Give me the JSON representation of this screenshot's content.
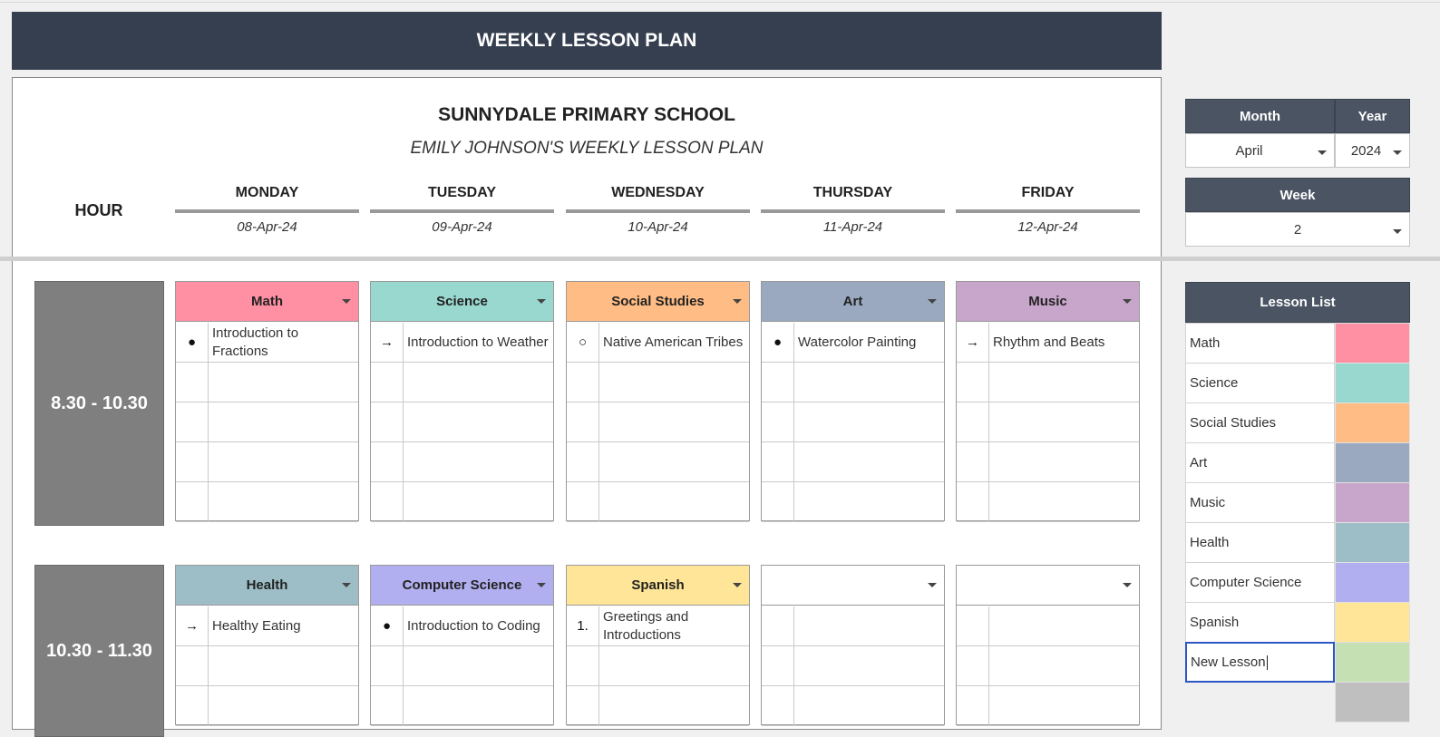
{
  "banner": {
    "title": "WEEKLY LESSON PLAN"
  },
  "header": {
    "school": "SUNNYDALE PRIMARY SCHOOL",
    "subtitle": "EMILY JOHNSON'S WEEKLY LESSON PLAN",
    "hour_label": "HOUR"
  },
  "days": [
    {
      "name": "MONDAY",
      "date": "08-Apr-24"
    },
    {
      "name": "TUESDAY",
      "date": "09-Apr-24"
    },
    {
      "name": "WEDNESDAY",
      "date": "10-Apr-24"
    },
    {
      "name": "THURSDAY",
      "date": "11-Apr-24"
    },
    {
      "name": "FRIDAY",
      "date": "12-Apr-24"
    }
  ],
  "periods": [
    {
      "time": "8.30 - 10.30",
      "lessons": [
        {
          "subject": "Math",
          "color": "#ff8fa3",
          "items": [
            {
              "mark": "●",
              "text": "Introduction to Fractions"
            }
          ]
        },
        {
          "subject": "Science",
          "color": "#99d8cf",
          "items": [
            {
              "mark": "→",
              "text": "Introduction to Weather"
            }
          ]
        },
        {
          "subject": "Social Studies",
          "color": "#ffbd85",
          "items": [
            {
              "mark": "○",
              "text": "Native American Tribes"
            }
          ]
        },
        {
          "subject": "Art",
          "color": "#9aa9bf",
          "items": [
            {
              "mark": "●",
              "text": "Watercolor Painting"
            }
          ]
        },
        {
          "subject": "Music",
          "color": "#c8a5cb",
          "items": [
            {
              "mark": "→",
              "text": "Rhythm and Beats"
            }
          ]
        }
      ]
    },
    {
      "time": "10.30 - 11.30",
      "lessons": [
        {
          "subject": "Health",
          "color": "#9dbec6",
          "items": [
            {
              "mark": "→",
              "text": "Healthy Eating"
            }
          ]
        },
        {
          "subject": "Computer Science",
          "color": "#b1afef",
          "items": [
            {
              "mark": "●",
              "text": "Introduction to Coding"
            }
          ]
        },
        {
          "subject": "Spanish",
          "color": "#ffe597",
          "items": [
            {
              "mark": "1.",
              "text": "Greetings and Introductions"
            }
          ]
        },
        {
          "subject": "",
          "color": "#ffffff",
          "items": []
        },
        {
          "subject": "",
          "color": "#ffffff",
          "items": []
        }
      ]
    }
  ],
  "controls": {
    "month_label": "Month",
    "year_label": "Year",
    "month_value": "April",
    "year_value": "2024",
    "week_label": "Week",
    "week_value": "2"
  },
  "lesson_list": {
    "title": "Lesson List",
    "items": [
      {
        "name": "Math",
        "color": "#ff8fa3"
      },
      {
        "name": "Science",
        "color": "#99d8cf"
      },
      {
        "name": "Social Studies",
        "color": "#ffbd85"
      },
      {
        "name": "Art",
        "color": "#9aa9bf"
      },
      {
        "name": "Music",
        "color": "#c8a5cb"
      },
      {
        "name": "Health",
        "color": "#9dbec6"
      },
      {
        "name": "Computer Science",
        "color": "#b1afef"
      },
      {
        "name": "Spanish",
        "color": "#ffe597"
      }
    ],
    "editing": {
      "value": "New Lesson",
      "color": "#c5e0b3"
    },
    "blank_color": "#bfbfbf"
  }
}
